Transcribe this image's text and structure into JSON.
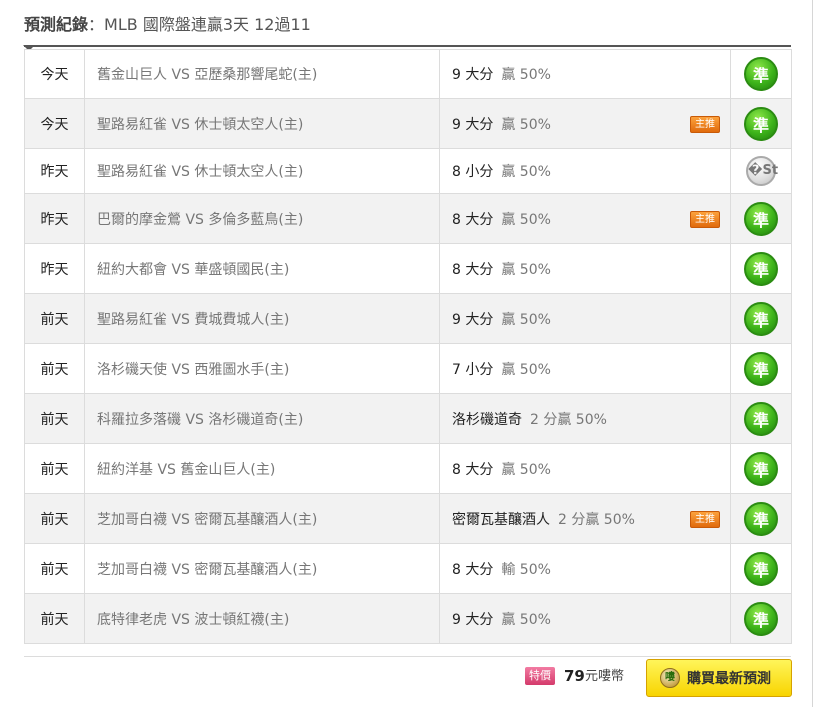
{
  "header": {
    "title_label": "預測紀錄",
    "title_separator": "：",
    "title_text": "MLB 國際盤連贏3天 12過11"
  },
  "records": [
    {
      "day": "今天",
      "match": "舊金山巨人 VS 亞歷桑那響尾蛇(主)",
      "pick_main": "9 大分",
      "pick_detail": "贏 50%",
      "promo": "",
      "result": "準",
      "result_type": "win"
    },
    {
      "day": "今天",
      "match": "聖路易紅雀 VS 休士頓太空人(主)",
      "pick_main": "9 大分",
      "pick_detail": "贏 50%",
      "promo": "主推",
      "result": "準",
      "result_type": "win"
    },
    {
      "day": "昨天",
      "match": "聖路易紅雀 VS 休士頓太空人(主)",
      "pick_main": "8 小分",
      "pick_detail": "贏 50%",
      "promo": "",
      "result": "�St",
      "result_type": "push"
    },
    {
      "day": "昨天",
      "match": "巴爾的摩金鶯 VS 多倫多藍鳥(主)",
      "pick_main": "8 大分",
      "pick_detail": "贏 50%",
      "promo": "主推",
      "result": "準",
      "result_type": "win"
    },
    {
      "day": "昨天",
      "match": "紐約大都會 VS 華盛頓國民(主)",
      "pick_main": "8 大分",
      "pick_detail": "贏 50%",
      "promo": "",
      "result": "準",
      "result_type": "win"
    },
    {
      "day": "前天",
      "match": "聖路易紅雀 VS 費城費城人(主)",
      "pick_main": "9 大分",
      "pick_detail": "贏 50%",
      "promo": "",
      "result": "準",
      "result_type": "win"
    },
    {
      "day": "前天",
      "match": "洛杉磯天使 VS 西雅圖水手(主)",
      "pick_main": "7 小分",
      "pick_detail": "贏 50%",
      "promo": "",
      "result": "準",
      "result_type": "win"
    },
    {
      "day": "前天",
      "match": "科羅拉多落磯 VS 洛杉磯道奇(主)",
      "pick_main": "洛杉磯道奇",
      "pick_detail": "2 分贏 50%",
      "promo": "",
      "result": "準",
      "result_type": "win"
    },
    {
      "day": "前天",
      "match": "紐約洋基 VS 舊金山巨人(主)",
      "pick_main": "8 大分",
      "pick_detail": "贏 50%",
      "promo": "",
      "result": "準",
      "result_type": "win"
    },
    {
      "day": "前天",
      "match": "芝加哥白襪 VS 密爾瓦基釀酒人(主)",
      "pick_main": "密爾瓦基釀酒人",
      "pick_detail": "2 分贏 50%",
      "promo": "主推",
      "result": "準",
      "result_type": "win"
    },
    {
      "day": "前天",
      "match": "芝加哥白襪 VS 密爾瓦基釀酒人(主)",
      "pick_main": "8 大分",
      "pick_detail": "輸 50%",
      "promo": "",
      "result": "準",
      "result_type": "win"
    },
    {
      "day": "前天",
      "match": "底特律老虎 VS 波士頓紅襪(主)",
      "pick_main": "9 大分",
      "pick_detail": "贏 50%",
      "promo": "",
      "result": "準",
      "result_type": "win"
    }
  ],
  "footer": {
    "special_label": "特價",
    "price_amount": "79",
    "price_unit": "元嘍幣",
    "buy_icon_text": "嘍",
    "buy_label": "購買最新預測"
  },
  "colors": {
    "win": "#3db31a",
    "push": "#bdbdbd",
    "promo": "#f08a1e",
    "special": "#e05585",
    "buy_button": "#f8e01a"
  }
}
